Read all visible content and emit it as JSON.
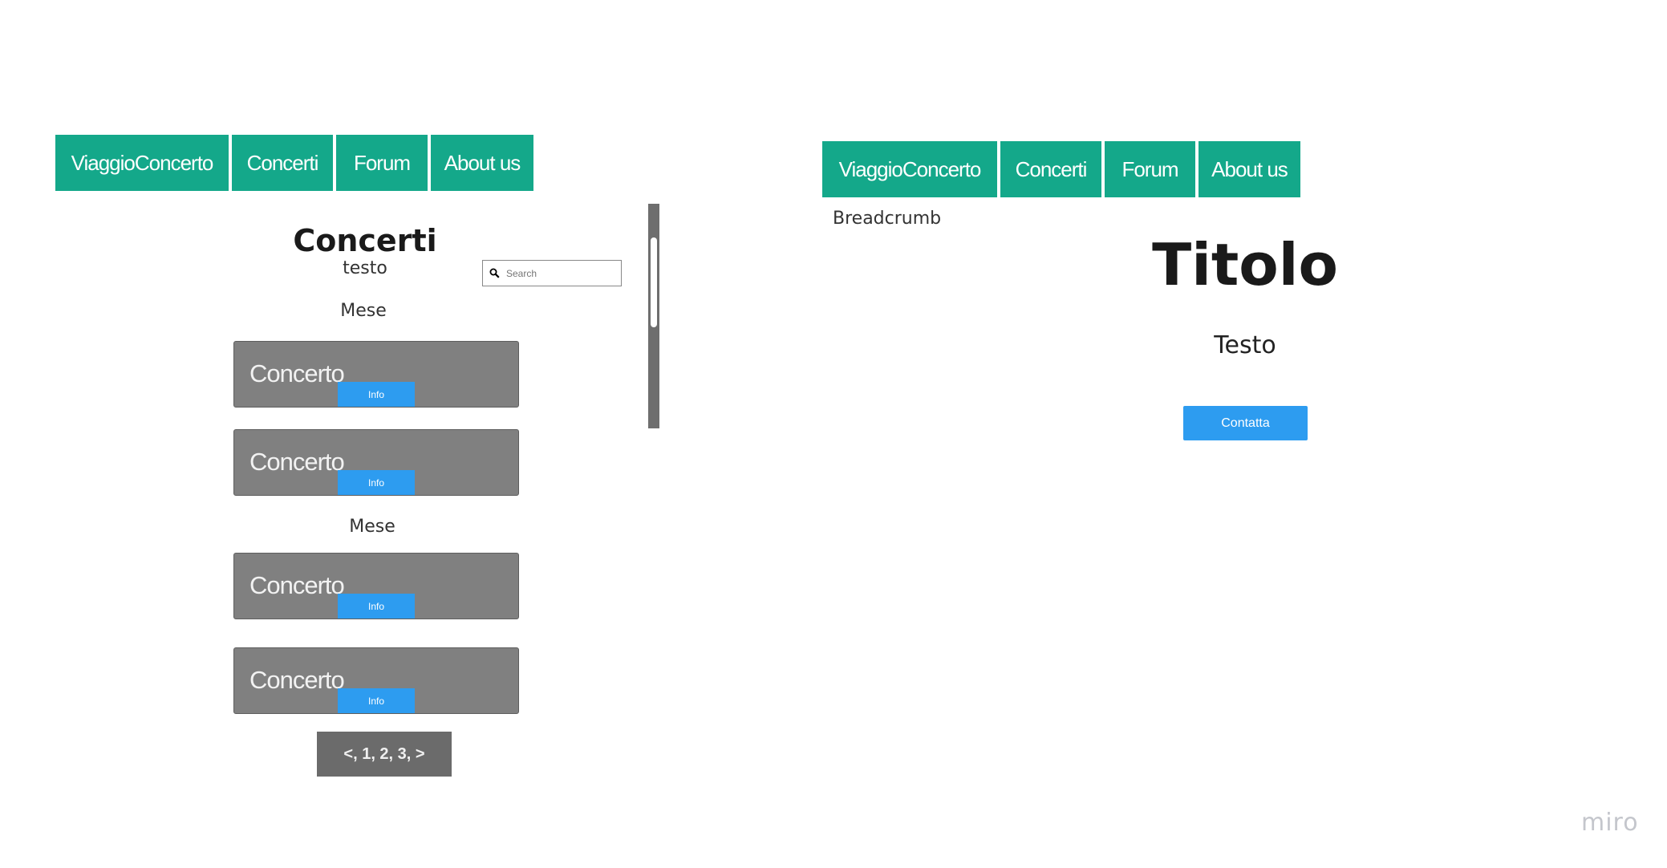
{
  "left_page": {
    "nav": [
      "ViaggioConcerto",
      "Concerti",
      "Forum",
      "About us"
    ],
    "title": "Concerti",
    "subtitle": "testo",
    "search_placeholder": "Search",
    "month_label_1": "Mese",
    "month_label_2": "Mese",
    "cards": [
      {
        "label": "Concerto",
        "button": "Info"
      },
      {
        "label": "Concerto",
        "button": "Info"
      },
      {
        "label": "Concerto",
        "button": "Info"
      },
      {
        "label": "Concerto",
        "button": "Info"
      }
    ],
    "pagination": "<, 1, 2, 3, >"
  },
  "right_page": {
    "nav": [
      "ViaggioConcerto",
      "Concerti",
      "Forum",
      "About us"
    ],
    "breadcrumb": "Breadcrumb",
    "title": "Titolo",
    "text": "Testo",
    "contact_button": "Contatta"
  },
  "watermark": "miro",
  "colors": {
    "nav_bg": "#14a88a",
    "button_blue": "#2d9cf0",
    "card_gray": "#808080",
    "pagination_gray": "#6b6b6b"
  }
}
